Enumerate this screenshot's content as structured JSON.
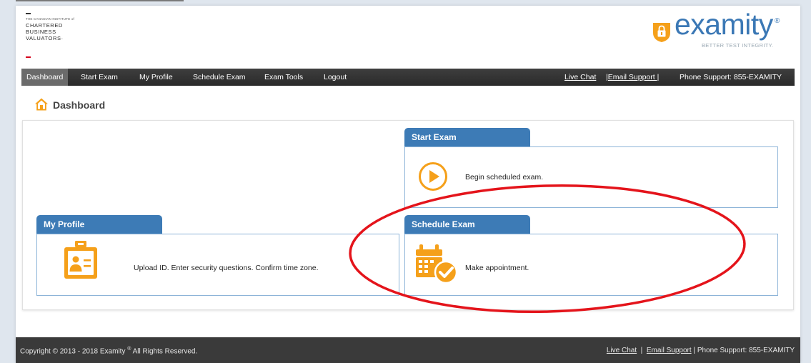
{
  "logo_left": {
    "institute_line": "THE CANADIAN INSTITUTE of",
    "line1": "CHARTERED",
    "line2": "BUSINESS",
    "line3": "VALUATORS",
    "line3_mark": "·"
  },
  "logo_right": {
    "wordmark": "examity",
    "registered": "®",
    "tagline": "BETTER TEST INTEGRITY."
  },
  "nav": {
    "items": [
      {
        "label": "Dashboard"
      },
      {
        "label": "Start Exam"
      },
      {
        "label": "My Profile"
      },
      {
        "label": "Schedule Exam"
      },
      {
        "label": "Exam Tools"
      },
      {
        "label": "Logout"
      }
    ],
    "live_chat": "Live Chat",
    "email_support": "|Email Support |",
    "phone_support": "Phone Support: 855-EXAMITY"
  },
  "page": {
    "title": "Dashboard"
  },
  "cards": {
    "start_exam": {
      "title": "Start Exam",
      "text": "Begin scheduled exam."
    },
    "my_profile": {
      "title": "My Profile",
      "text": "Upload ID. Enter security questions. Confirm time zone."
    },
    "schedule_exam": {
      "title": "Schedule Exam",
      "text": "Make appointment."
    }
  },
  "footer": {
    "copyright": "Copyright © 2013 - 2018 Examity",
    "registered": "®",
    "rights": " All Rights Reserved.",
    "live_chat": "Live Chat",
    "separator1": "  |  ",
    "email_support": "Email Support",
    "separator2": " | ",
    "phone_support": "Phone Support: 855-EXAMITY"
  },
  "icons": {
    "home": "home-icon",
    "play": "play-circle-icon",
    "profile": "id-badge-icon",
    "calendar": "calendar-check-icon",
    "shield": "lock-shield-icon"
  },
  "colors": {
    "accent_blue": "#3d7bb6",
    "icon_orange": "#f5a01a",
    "nav_dark": "#333333",
    "annotation_red": "#e4141b"
  }
}
